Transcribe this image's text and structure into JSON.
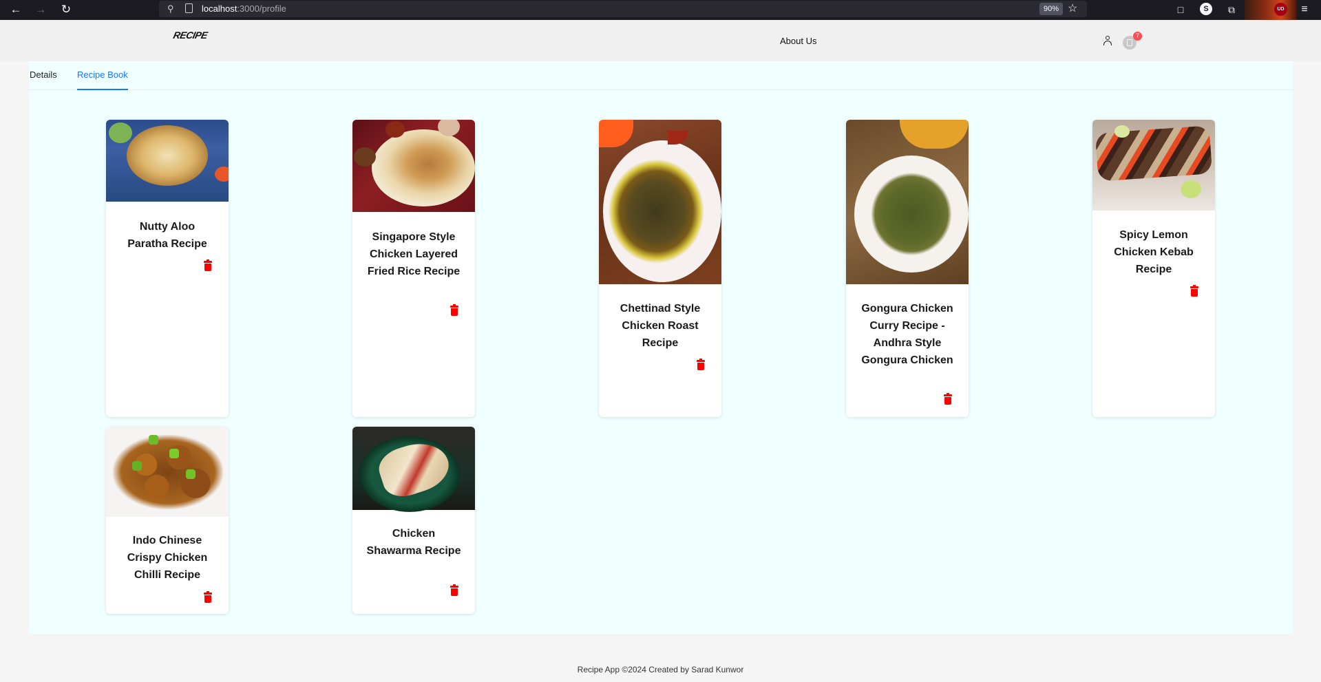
{
  "browser": {
    "url_host": "localhost",
    "url_path": ":3000/profile",
    "zoom": "90%",
    "back_icon": "arrow-left-icon",
    "forward_icon": "arrow-right-icon",
    "reload_icon": "reload-icon",
    "extension_s_label": "S",
    "extension_ud_label": "UD"
  },
  "header": {
    "logo_text": "RECIPE",
    "nav": {
      "about": "About Us"
    },
    "cart_count": "7"
  },
  "tabs": [
    {
      "label": "Details",
      "active": false
    },
    {
      "label": "Recipe Book",
      "active": true
    }
  ],
  "recipes": [
    {
      "title": "Nutty Aloo Paratha Recipe",
      "image": "aloo-paratha"
    },
    {
      "title": "Singapore Style Chicken Layered Fried Rice Recipe",
      "image": "fried-rice"
    },
    {
      "title": "Chettinad Style Chicken Roast Recipe",
      "image": "chicken-roast"
    },
    {
      "title": "Gongura Chicken Curry Recipe - Andhra Style Gongura Chicken",
      "image": "gongura-curry"
    },
    {
      "title": "Spicy Lemon Chicken Kebab Recipe",
      "image": "chicken-kebab"
    },
    {
      "title": "Indo Chinese Crispy Chicken Chilli Recipe",
      "image": "chicken-chilli"
    },
    {
      "title": "Chicken Shawarma Recipe",
      "image": "shawarma"
    }
  ],
  "footer": {
    "text": "Recipe App ©2024 Created by Sarad Kunwor"
  },
  "colors": {
    "accent": "#1677ff",
    "content_bg": "#f0ffff",
    "delete": "#ff0000",
    "badge": "#ff4d4f"
  }
}
